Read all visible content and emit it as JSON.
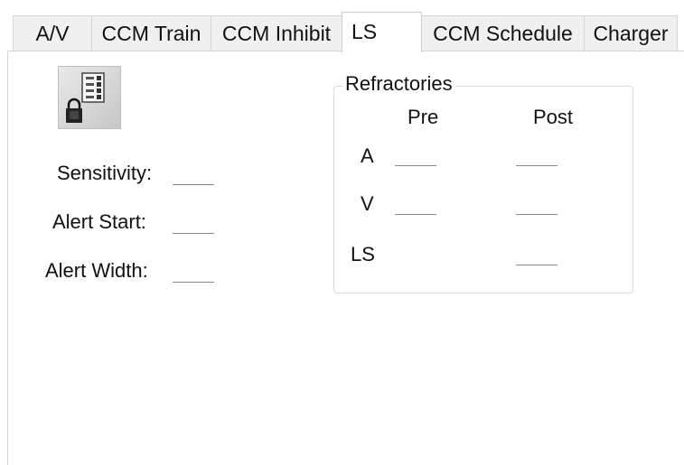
{
  "tabs": [
    {
      "label": "A/V"
    },
    {
      "label": "CCM Train"
    },
    {
      "label": "CCM Inhibit"
    },
    {
      "label": "LS"
    },
    {
      "label": "CCM Schedule"
    },
    {
      "label": "Charger"
    }
  ],
  "active_tab": "LS",
  "settings": {
    "sensitivity_label": "Sensitivity:",
    "sensitivity_value": "",
    "alert_start_label": "Alert Start:",
    "alert_start_value": "",
    "alert_width_label": "Alert Width:",
    "alert_width_value": ""
  },
  "refractories": {
    "title": "Refractories",
    "col_pre": "Pre",
    "col_post": "Post",
    "rows": [
      {
        "label": "A",
        "pre": "",
        "post": ""
      },
      {
        "label": "V",
        "pre": "",
        "post": ""
      },
      {
        "label": "LS",
        "post": ""
      }
    ]
  },
  "icon": "settings-list-lock-icon"
}
